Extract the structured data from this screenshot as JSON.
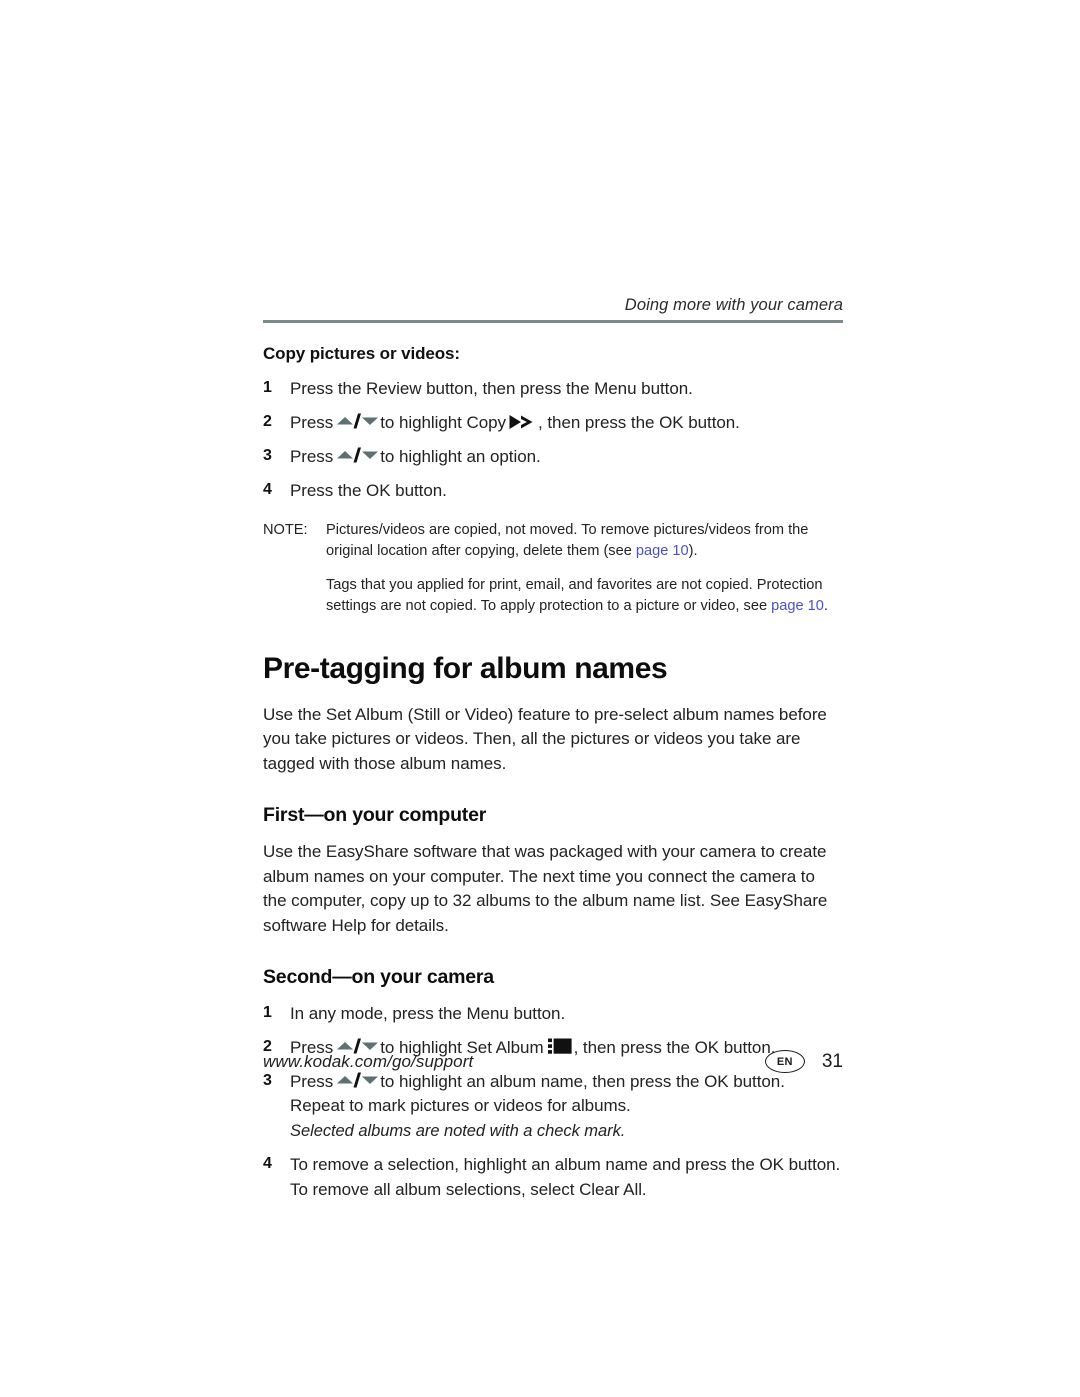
{
  "header": {
    "running_title": "Doing more with your camera",
    "rule_color": "#7d8a8c"
  },
  "section_copy": {
    "lead": "Copy pictures or videos:",
    "steps": [
      {
        "num": "1",
        "before": "Press the Review button, then press the Menu button.",
        "icon": null,
        "after": ""
      },
      {
        "num": "2",
        "before": "Press",
        "icon": "updown-arrows-icon",
        "mid": "to highlight Copy",
        "icon2": "copy-fast-forward-icon",
        "after": ", then press the OK button."
      },
      {
        "num": "3",
        "before": "Press",
        "icon": "updown-arrows-icon",
        "mid": "to highlight an option.",
        "after": ""
      },
      {
        "num": "4",
        "before": "Press the OK button.",
        "icon": null,
        "after": ""
      }
    ]
  },
  "note": {
    "label": "NOTE:",
    "para1_a": "Pictures/videos are copied, not moved. To remove pictures/videos from the original location after copying, delete them (see ",
    "para1_link": "page 10",
    "para1_b": ").",
    "para2_a": "Tags that you applied for print, email, and favorites are not copied. Protection settings are not copied. To apply protection to a picture or video, see ",
    "para2_link": "page 10",
    "para2_b": ".",
    "link_color": "#4952c4"
  },
  "main": {
    "title": "Pre-tagging for album names",
    "intro": "Use the Set Album (Still or Video) feature to pre-select album names before you take pictures or videos. Then, all the pictures or videos you take are tagged with those album names."
  },
  "first_section": {
    "heading": "First—on your computer",
    "body": "Use the EasyShare software that was packaged with your camera to create album names on your computer. The next time you connect the camera to the computer, copy up to 32 albums to the album name list. See EasyShare software Help for details."
  },
  "second_section": {
    "heading": "Second—on your camera",
    "step1": "In any mode, press the Menu button.",
    "step2_a": "Press",
    "step2_b": "to highlight Set Album",
    "step2_c": ", then press the OK button.",
    "step3_a": "Press",
    "step3_b": "to highlight an album name, then press the OK button. Repeat to mark pictures or videos for albums.",
    "step3_italic": "Selected albums are noted with a check mark.",
    "step4": "To remove a selection, highlight an album name and press the OK button. To remove all album selections, select Clear All.",
    "nums": {
      "one": "1",
      "two": "2",
      "three": "3",
      "four": "4"
    }
  },
  "footer": {
    "url": "www.kodak.com/go/support",
    "language": "EN",
    "page_number": "31"
  },
  "icons": {
    "updown": "updown-arrows-icon",
    "copy": "copy-fast-forward-icon",
    "album": "set-album-icon",
    "arrow_color": "#5d7072"
  }
}
